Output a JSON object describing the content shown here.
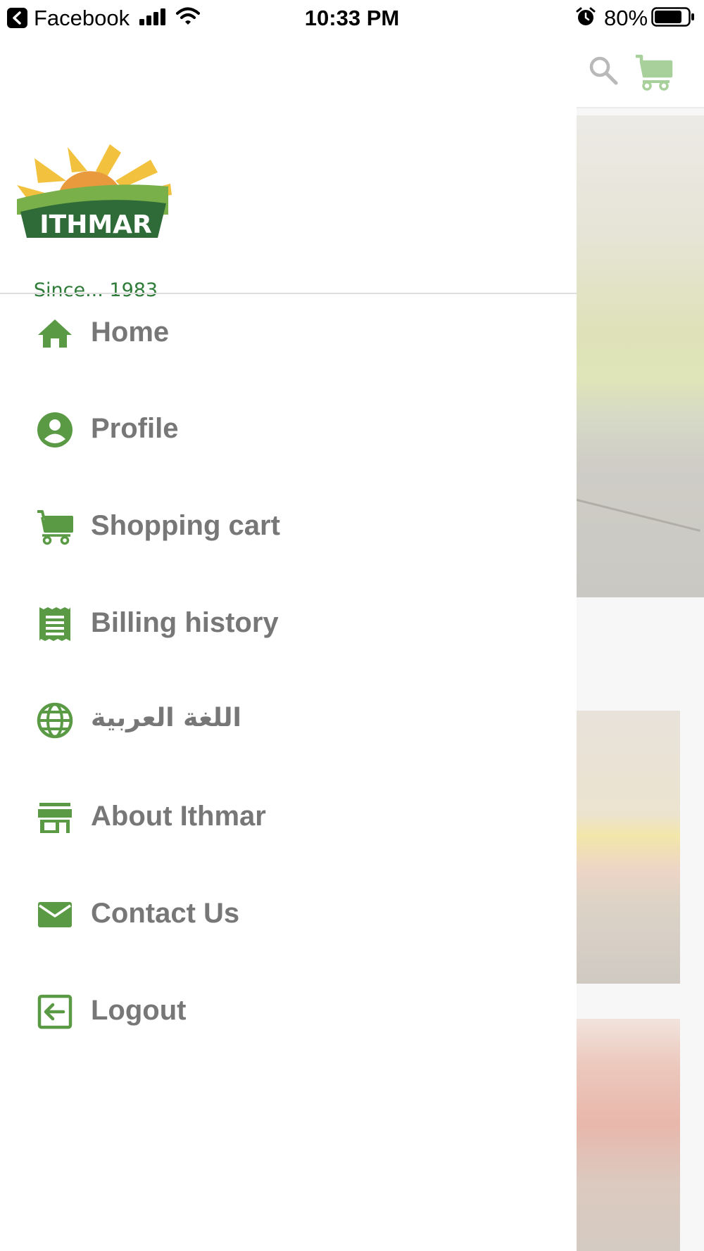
{
  "status_bar": {
    "back_app": "Facebook",
    "time": "10:33 PM",
    "battery_percent": "80%"
  },
  "drawer": {
    "logo": {
      "brand_name": "ITHMAR",
      "tagline": "Since... 1983"
    },
    "menu": [
      {
        "label": "Home",
        "icon": "home-icon"
      },
      {
        "label": "Profile",
        "icon": "account-circle-icon"
      },
      {
        "label": "Shopping cart",
        "icon": "cart-icon"
      },
      {
        "label": "Billing history",
        "icon": "receipt-icon"
      },
      {
        "label": "اللغة العربية",
        "icon": "globe-icon"
      },
      {
        "label": "About Ithmar",
        "icon": "store-icon"
      },
      {
        "label": "Contact Us",
        "icon": "mail-icon"
      },
      {
        "label": "Logout",
        "icon": "logout-icon"
      }
    ]
  },
  "colors": {
    "accent_green": "#5a9a45",
    "menu_text": "#777777",
    "logo_yellow": "#f2c23e",
    "logo_orange": "#e89a3c",
    "logo_dark_green": "#2e6b38"
  }
}
